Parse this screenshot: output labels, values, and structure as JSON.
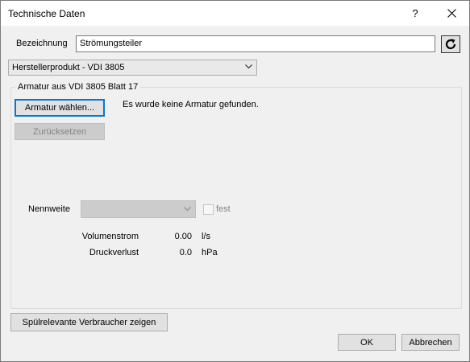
{
  "window": {
    "title": "Technische Daten",
    "help_label": "?"
  },
  "bezeichnung": {
    "label": "Bezeichnung",
    "value": "Strömungsteiler"
  },
  "hersteller_select": {
    "value": "Herstellerprodukt - VDI 3805"
  },
  "armatur_group": {
    "title": "Armatur aus VDI 3805 Blatt 17",
    "choose_button": "Armatur wählen...",
    "status_text": "Es wurde keine Armatur gefunden.",
    "reset_button": "Zurücksetzen"
  },
  "nennweite": {
    "label": "Nennweite",
    "value": "",
    "fest_label": "fest",
    "fest_checked": false
  },
  "measurements": [
    {
      "label": "Volumenstrom",
      "value": "0.00",
      "unit": "l/s"
    },
    {
      "label": "Druckverlust",
      "value": "0.0",
      "unit": "hPa"
    }
  ],
  "footer": {
    "spuel_button": "Spülrelevante Verbraucher zeigen",
    "ok_button": "OK",
    "cancel_button": "Abbrechen"
  },
  "colors": {
    "accent": "#0078d7",
    "dialog_bg": "#f0f0f0",
    "disabled_text": "#838383"
  }
}
